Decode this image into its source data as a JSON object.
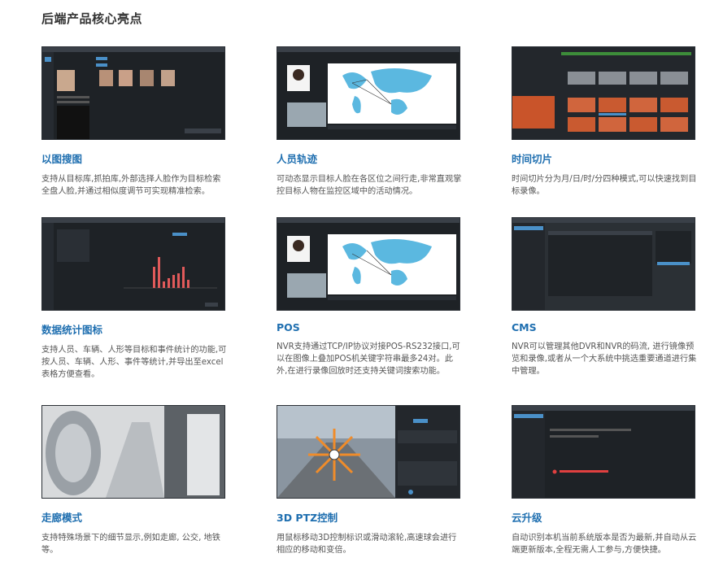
{
  "page": {
    "title": "后端产品核心亮点"
  },
  "features": [
    {
      "title": "以图搜图",
      "desc": "支持从目标库,抓拍库,外部选择人脸作为目标检索全盘人脸,并通过相似度调节可实现精准检索。"
    },
    {
      "title": "人员轨迹",
      "desc": "可动态显示目标人脸在各区位之间行走,非常直观掌控目标人物在监控区域中的活动情况。"
    },
    {
      "title": "时间切片",
      "desc": "时间切片分为月/日/时/分四种模式,可以快速找到目标录像。"
    },
    {
      "title": "数据统计图标",
      "desc": "支持人员、车辆、人形等目标和事件统计的功能,可按人员、车辆、人形、事件等统计,并导出至excel表格方便查看。"
    },
    {
      "title": "POS",
      "desc": "NVR支持通过TCP/IP协议对接POS-RS232接口,可以在图像上叠加POS机关键字符串最多24对。此外,在进行录像回放时还支持关键词搜索功能。"
    },
    {
      "title": "CMS",
      "desc": "NVR可以管理其他DVR和NVR的码流, 进行镜像预览和录像,或者从一个大系统中挑选重要通道进行集中管理。"
    },
    {
      "title": "走廊模式",
      "desc": "支持特殊场景下的细节显示,例如走廊, 公交, 地铁等。"
    },
    {
      "title": "3D PTZ控制",
      "desc": "用鼠标移动3D控制标识或滑动滚轮,高速球会进行相应的移动和变倍。"
    },
    {
      "title": "云升级",
      "desc": "自动识别本机当前系统版本是否为最新,并自动从云端更新版本,全程无需人工参与,方便快捷。"
    }
  ],
  "colors": {
    "title_blue": "#1f6fb0",
    "ui_dark": "#1e2226",
    "map_blue": "#5bb8e0",
    "bar_red": "#e05a5a"
  }
}
